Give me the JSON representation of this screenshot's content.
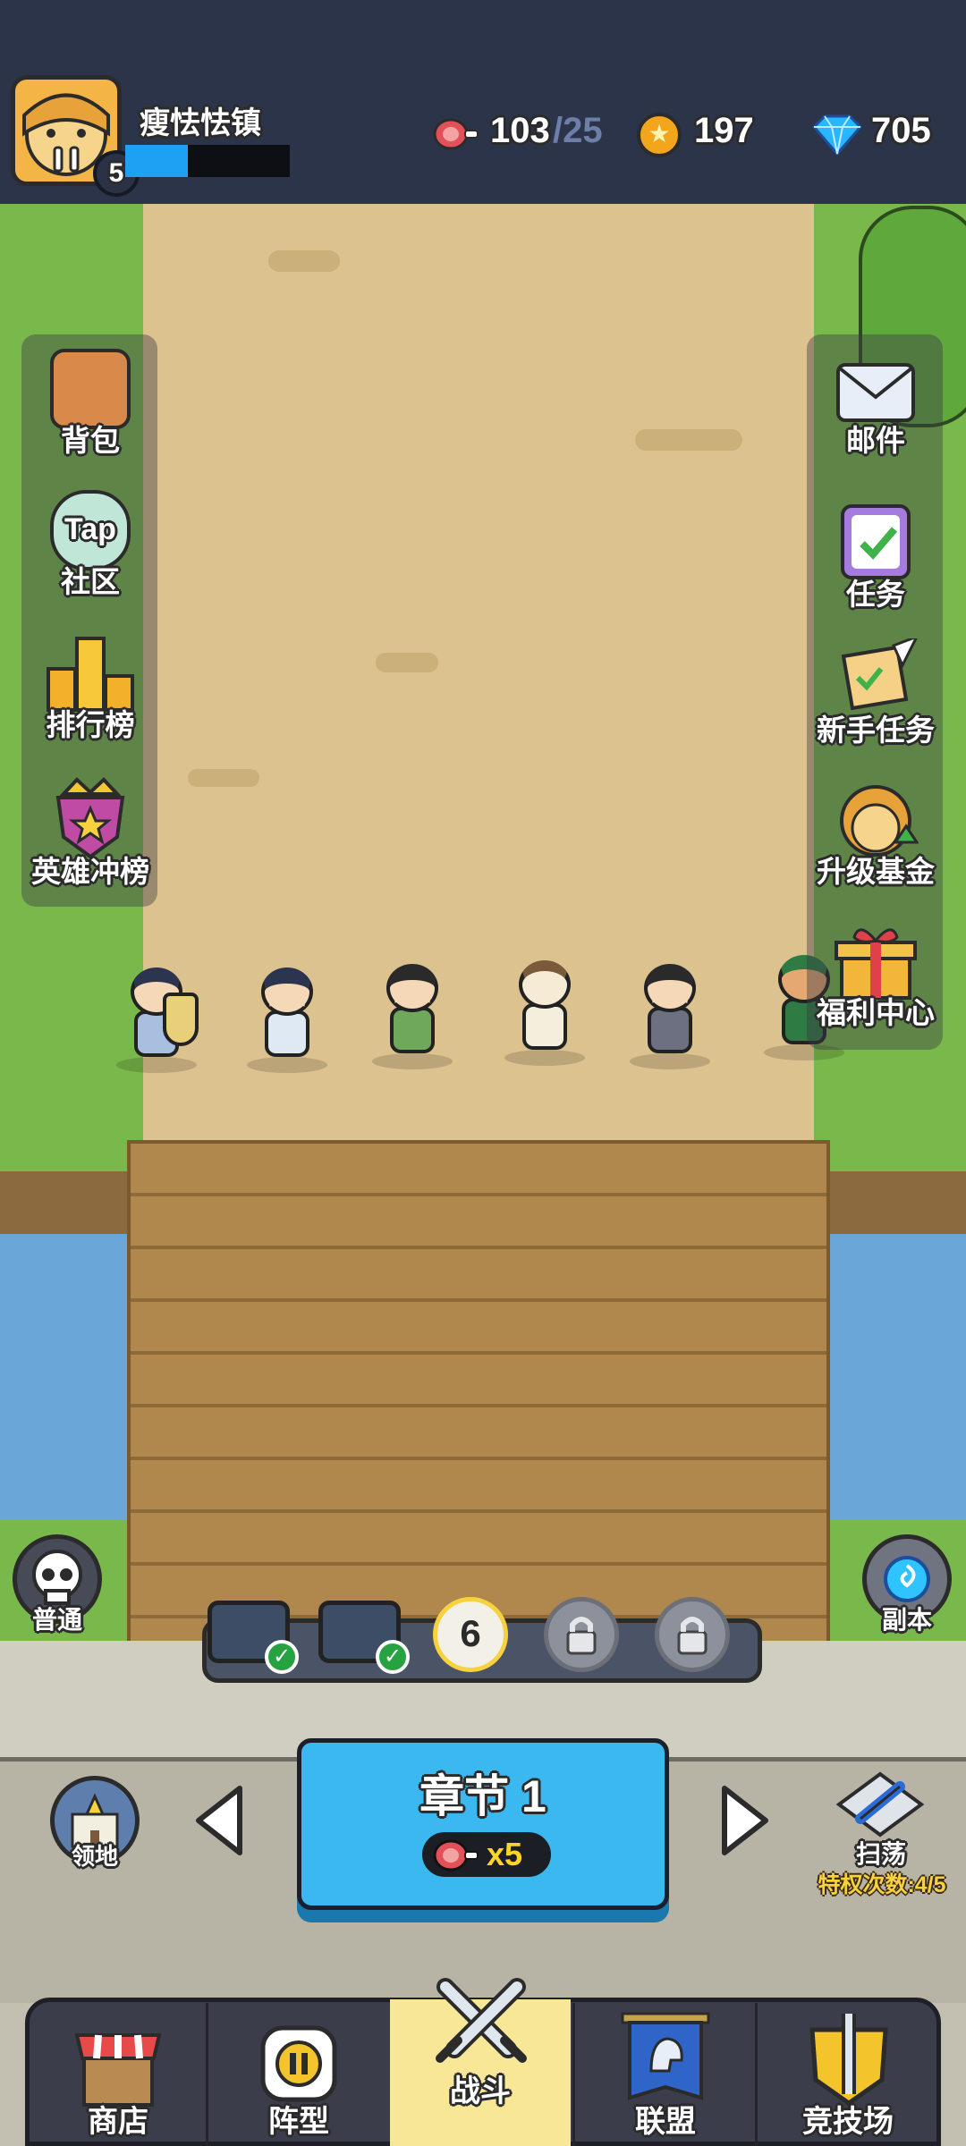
{
  "player": {
    "name": "瘦怯怯镇",
    "level": "5",
    "xp_fraction": 0.38
  },
  "resources": {
    "stamina_current": "103",
    "stamina_max": "/25",
    "gold": "197",
    "gems": "705"
  },
  "left_menu": [
    {
      "label": "背包",
      "icon": "backpack-icon"
    },
    {
      "label": "社区",
      "icon": "tap-community-icon",
      "icon_text": "Tap"
    },
    {
      "label": "排行榜",
      "icon": "leaderboard-icon"
    },
    {
      "label": "英雄冲榜",
      "icon": "hero-rank-icon"
    }
  ],
  "right_menu": [
    {
      "label": "邮件",
      "icon": "mail-icon"
    },
    {
      "label": "任务",
      "icon": "task-icon"
    },
    {
      "label": "新手任务",
      "icon": "newbie-task-icon"
    },
    {
      "label": "升级基金",
      "icon": "upgrade-fund-icon"
    },
    {
      "label": "福利中心",
      "icon": "gift-icon"
    }
  ],
  "difficulty": {
    "label": "普通",
    "icon": "skull-icon"
  },
  "dungeon": {
    "label": "副本",
    "icon": "portal-icon"
  },
  "stages": {
    "current": "6",
    "completed_chests": 2,
    "locked": 2
  },
  "territory": {
    "label": "领地",
    "icon": "castle-icon"
  },
  "chapter": {
    "title": "章节 1",
    "cost": "x5",
    "cost_icon": "meat-icon"
  },
  "sweep": {
    "label": "扫荡",
    "quota": "特权次数:4/5",
    "icon": "sweep-icon"
  },
  "tabs": [
    {
      "label": "商店",
      "icon": "shop-icon",
      "active": false
    },
    {
      "label": "阵型",
      "icon": "formation-icon",
      "active": false
    },
    {
      "label": "战斗",
      "icon": "crossed-swords-icon",
      "active": true
    },
    {
      "label": "联盟",
      "icon": "alliance-icon",
      "active": false
    },
    {
      "label": "竞技场",
      "icon": "arena-icon",
      "active": false
    }
  ],
  "colors": {
    "accent_blue": "#3ab8ef",
    "active_tab": "#f7e796",
    "cost_yellow": "#ffd42a",
    "quota_yellow": "#f7d23e",
    "xp_blue": "#1ea1f2"
  }
}
